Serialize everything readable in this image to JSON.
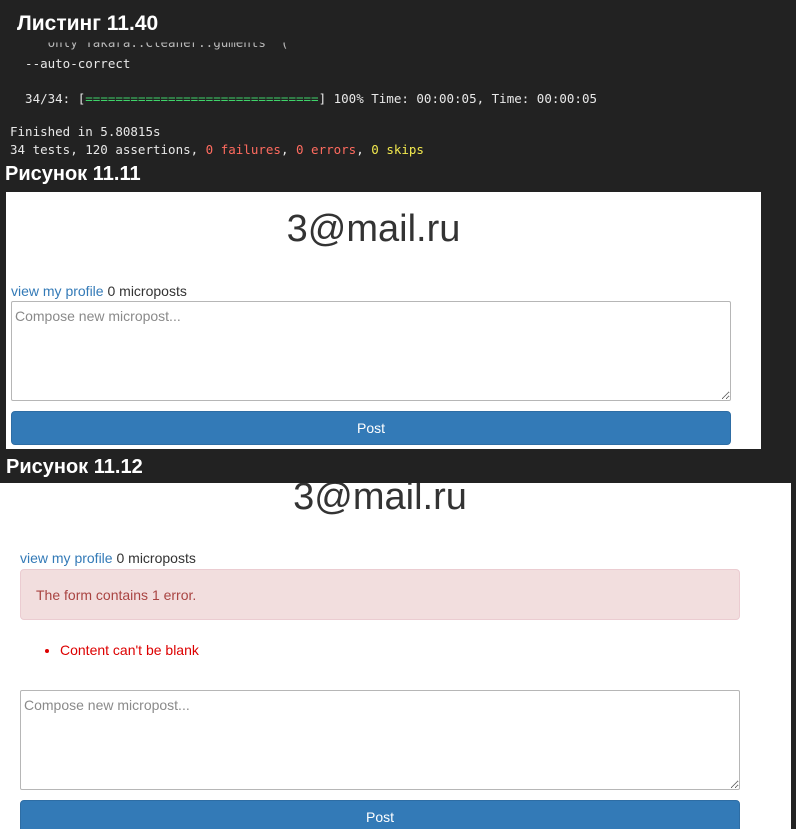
{
  "listing": {
    "title": "Листинг 11.40",
    "partial_line": "     only Takara::Cleaner::guments  (",
    "autocorrect_line": "  --auto-correct",
    "progress": {
      "prefix": "  34/34: [",
      "bar": "===============================",
      "suffix": "] 100% Time: 00:00:05, Time: 00:00:05",
      "percent": 100
    },
    "finished_line": "Finished in 5.80815s",
    "summary": {
      "tests": "34 tests, 120 assertions, ",
      "failures": "0 failures",
      "sep1": ", ",
      "errors": "0 errors",
      "sep2": ", ",
      "skips": "0 skips"
    }
  },
  "figure1": {
    "caption": "Рисунок 11.11",
    "email": "3@mail.ru",
    "profile_link": "view my profile",
    "micropost_count": " 0 microposts",
    "textarea_placeholder": "Compose new micropost...",
    "post_button": "Post"
  },
  "figure2": {
    "caption": "Рисунок 11.12",
    "email": "3@mail.ru",
    "profile_link": "view my profile",
    "micropost_count": " 0 microposts",
    "alert_text": "The form contains 1 error.",
    "errors": [
      "Content can't be blank"
    ],
    "textarea_placeholder": "Compose new micropost...",
    "post_button": "Post"
  },
  "colors": {
    "terminal_bg": "#222222",
    "link": "#337ab7",
    "button": "#337ab7",
    "alert_bg": "#f2dede",
    "alert_text": "#a94442",
    "error_text": "#dd0000",
    "terminal_green": "#3fd46a",
    "terminal_red": "#ff6b5f",
    "terminal_yellow": "#f2e94e"
  }
}
